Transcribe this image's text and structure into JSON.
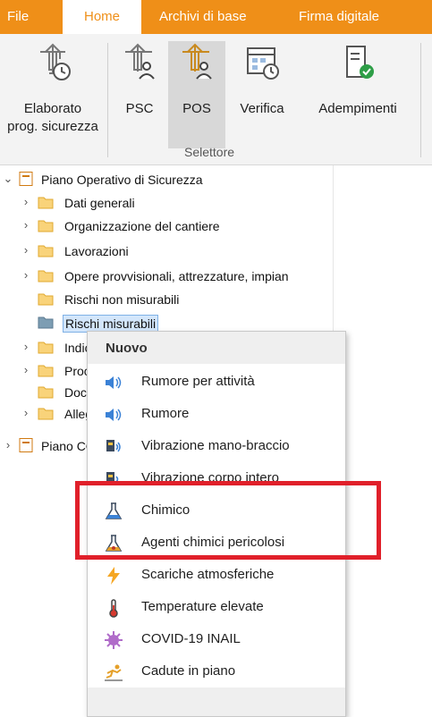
{
  "ribbon_tabs": [
    {
      "label": "File"
    },
    {
      "label": "Home"
    },
    {
      "label": "Archivi di base"
    },
    {
      "label": "Firma digitale"
    }
  ],
  "ribbon_buttons": [
    {
      "label_line1": "Elaborato",
      "label_line2": "prog. sicurezza",
      "icon": "crane-clock-icon"
    },
    {
      "label_line1": "PSC",
      "label_line2": "",
      "icon": "crane-people-icon"
    },
    {
      "label_line1": "POS",
      "label_line2": "",
      "icon": "crane-people-selected-icon"
    },
    {
      "label_line1": "Verifica",
      "label_line2": "",
      "icon": "calendar-clock-icon"
    },
    {
      "label_line1": "Adempimenti",
      "label_line2": "",
      "icon": "document-check-icon"
    }
  ],
  "ribbon_group_label": "Selettore",
  "tree": {
    "root": "Piano Operativo di Sicurezza",
    "children": [
      "Dati generali",
      "Organizzazione del cantiere",
      "Lavorazioni",
      "Opere provvisionali, attrezzature, impian",
      "Rischi non misurabili",
      "Rischi misurabili",
      "Indic",
      "Proc",
      "Docu",
      "Alleg"
    ],
    "root2": "Piano CC"
  },
  "context_menu": {
    "header": "Nuovo",
    "items": [
      {
        "label": "Rumore per attività",
        "icon": "speaker-icon"
      },
      {
        "label": "Rumore",
        "icon": "speaker-icon"
      },
      {
        "label": "Vibrazione mano-braccio",
        "icon": "vibration-tool-icon"
      },
      {
        "label": "Vibrazione corpo intero",
        "icon": "vibration-body-icon"
      },
      {
        "label": "Chimico",
        "icon": "flask-icon"
      },
      {
        "label": "Agenti chimici pericolosi",
        "icon": "flask-hazard-icon"
      },
      {
        "label": "Scariche atmosferiche",
        "icon": "lightning-icon"
      },
      {
        "label": "Temperature elevate",
        "icon": "thermometer-icon"
      },
      {
        "label": "COVID-19 INAIL",
        "icon": "virus-icon"
      },
      {
        "label": "Cadute in piano",
        "icon": "fall-icon"
      }
    ]
  },
  "colors": {
    "accent": "#ef8f18",
    "highlight": "#e0202a",
    "selection": "#d3e6fb"
  }
}
